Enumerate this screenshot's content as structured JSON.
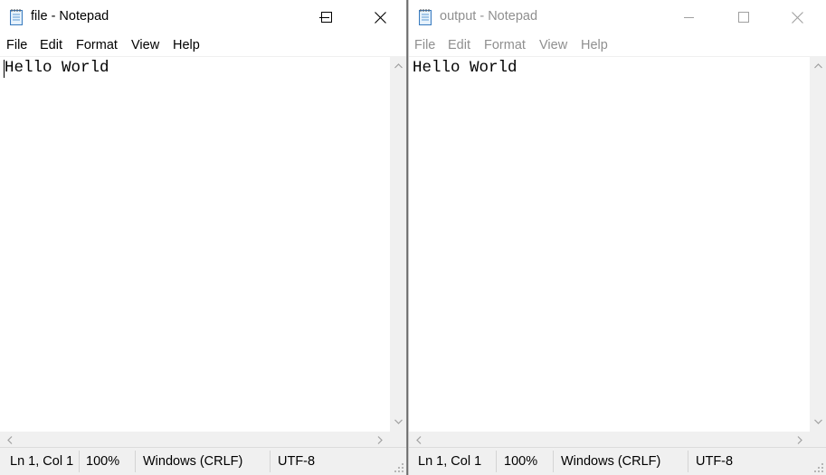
{
  "windows": [
    {
      "id": "left",
      "active": true,
      "title": "file - Notepad",
      "menu": [
        "File",
        "Edit",
        "Format",
        "View",
        "Help"
      ],
      "content": "Hello World",
      "status": {
        "position": "Ln 1, Col 1",
        "zoom": "100%",
        "line_ending": "Windows (CRLF)",
        "encoding": "UTF-8"
      }
    },
    {
      "id": "right",
      "active": false,
      "title": "output - Notepad",
      "menu": [
        "File",
        "Edit",
        "Format",
        "View",
        "Help"
      ],
      "content": "Hello World",
      "status": {
        "position": "Ln 1, Col 1",
        "zoom": "100%",
        "line_ending": "Windows (CRLF)",
        "encoding": "UTF-8"
      }
    }
  ],
  "icons": {
    "app": "notepad-icon",
    "minimize": "minimize-icon",
    "maximize": "maximize-icon",
    "close": "close-icon",
    "scroll_up": "chevron-up-icon",
    "scroll_down": "chevron-down-icon",
    "scroll_left": "chevron-left-icon",
    "scroll_right": "chevron-right-icon",
    "grip": "resize-grip-icon"
  },
  "colors": {
    "window_bg": "#ffffff",
    "statusbar_bg": "#f0f0f0",
    "inactive_text": "#8f8f8f",
    "active_text": "#000000"
  }
}
